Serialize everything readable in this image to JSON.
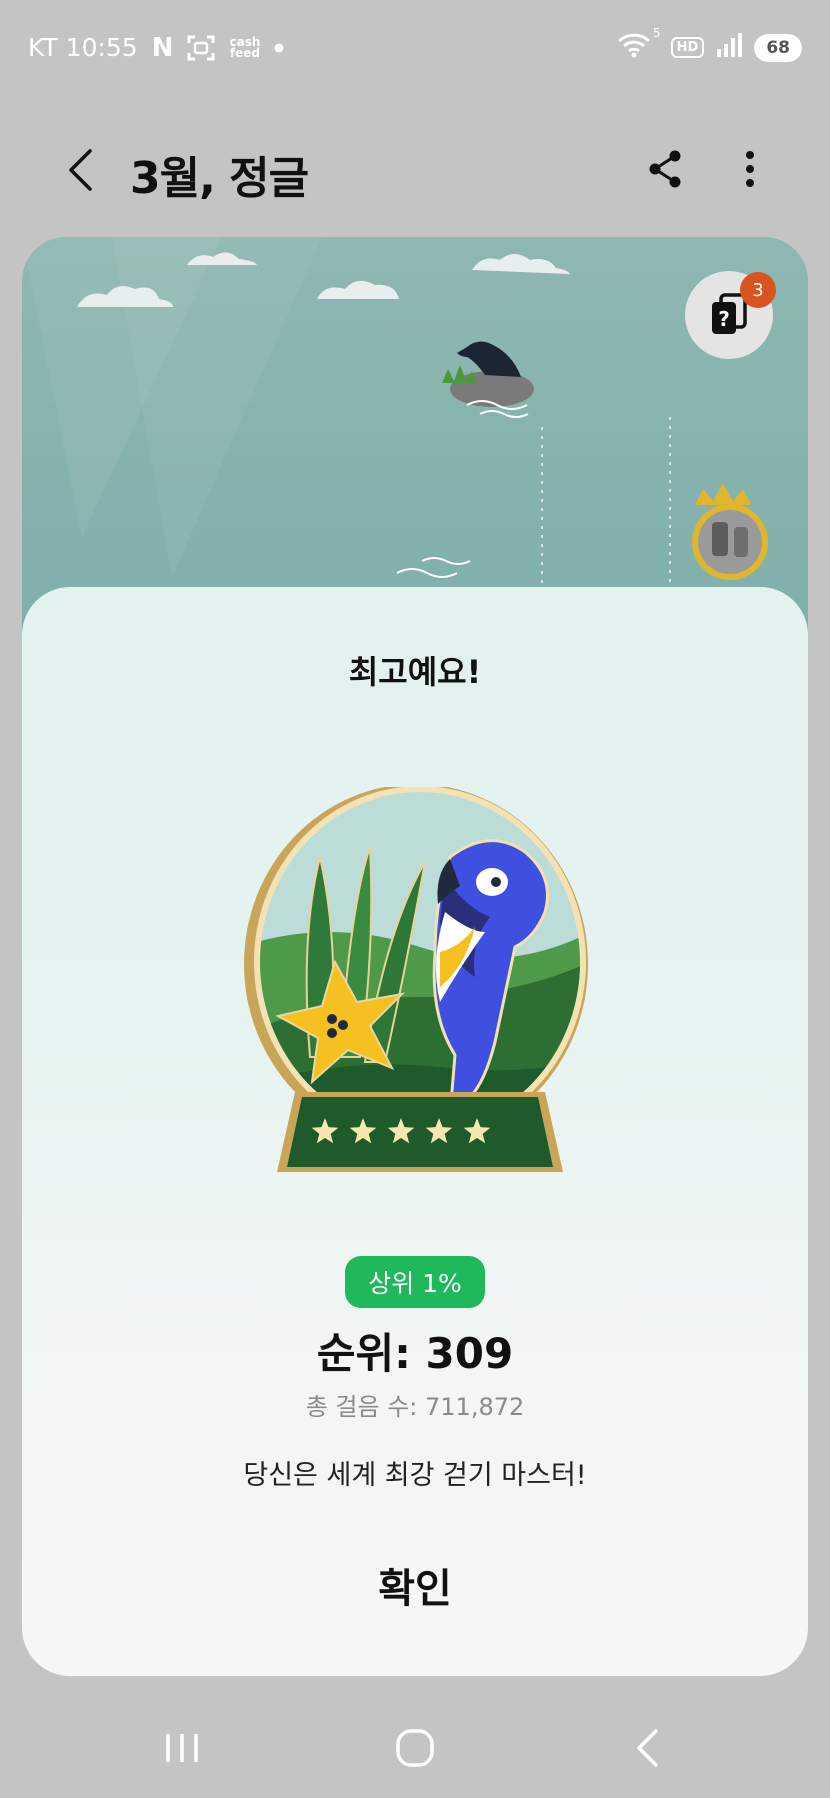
{
  "status_bar": {
    "carrier_time": "KT 10:55",
    "network_badge": "HD",
    "battery_level": "68",
    "icons": [
      "naver-n-icon",
      "screenshot-icon",
      "cashfeed-icon",
      "dot-icon",
      "wifi-icon",
      "signal-icon"
    ],
    "cash_label_top": "cash",
    "cash_label_bottom": "feed",
    "n_label": "N",
    "wifi_superscript": "5"
  },
  "app_bar": {
    "title": "3월, 정글",
    "icons": [
      "back-icon",
      "share-icon",
      "more-vertical-icon"
    ]
  },
  "scene": {
    "mystery_badge_count": "3",
    "mystery_symbol": "?"
  },
  "result_sheet": {
    "heading": "최고예요!",
    "top_percent_badge": "상위 1%",
    "rank": "순위: 309",
    "total_steps": "총 걸음 수: 711,872",
    "message": "당신은 세계 최강 걷기 마스터!",
    "confirm_label": "확인",
    "badge_stars": 5
  },
  "nav_bar": {
    "icons": [
      "recent-apps-icon",
      "home-icon",
      "back-nav-icon"
    ]
  },
  "colors": {
    "background_dim": "#c4c4c4",
    "scene_teal": "#8fb7b2",
    "accent_green": "#1fb85a",
    "notification_orange": "#d9541f",
    "parrot_blue": "#3f4fe0",
    "flower_yellow": "#f5c020"
  }
}
